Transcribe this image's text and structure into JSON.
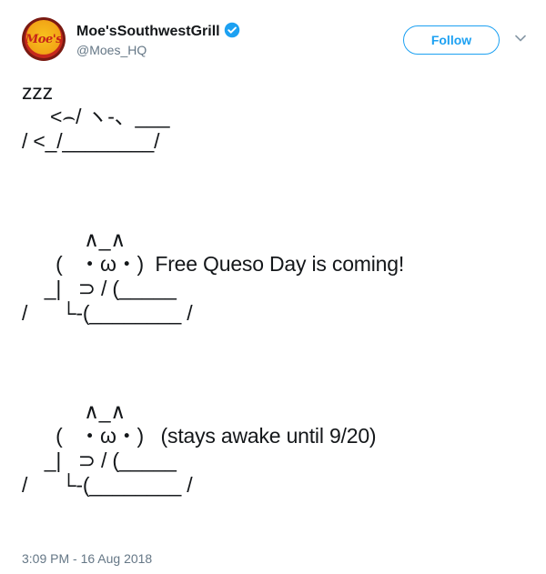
{
  "account": {
    "display_name": "Moe'sSouthwestGrill",
    "handle": "@Moes_HQ",
    "avatar_text": "Moe's",
    "verified_icon": "verified-badge-icon"
  },
  "actions": {
    "follow_label": "Follow",
    "menu_icon": "chevron-down-icon"
  },
  "tweet": {
    "text": "zzz\n     <⌢/ ヽ-、___\n/ <_/________/\n\n\n\n           ∧_∧\n      (   ・ω・)  Free Queso Day is coming!\n    _|   ⊃ / (_____\n/      └-(________ /\n\n\n\n           ∧_∧\n      (   ・ω・)   (stays awake until 9/20)\n    _|   ⊃ / (_____\n/      └-(________ /",
    "timestamp": "3:09 PM - 16 Aug 2018"
  },
  "colors": {
    "accent": "#1da1f2",
    "muted": "#657786",
    "text": "#14171a"
  }
}
